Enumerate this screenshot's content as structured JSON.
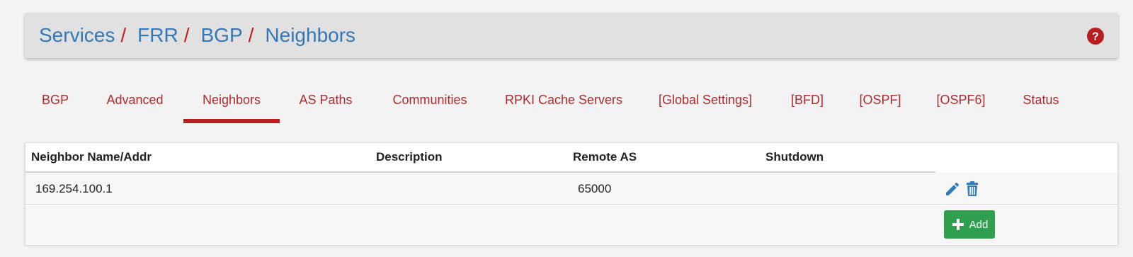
{
  "breadcrumb": {
    "items": [
      "Services",
      "FRR",
      "BGP",
      "Neighbors"
    ],
    "separator": "/"
  },
  "tabs": [
    {
      "label": "BGP",
      "active": false
    },
    {
      "label": "Advanced",
      "active": false
    },
    {
      "label": "Neighbors",
      "active": true
    },
    {
      "label": "AS Paths",
      "active": false
    },
    {
      "label": "Communities",
      "active": false
    },
    {
      "label": "RPKI Cache Servers",
      "active": false
    },
    {
      "label": "[Global Settings]",
      "active": false
    },
    {
      "label": "[BFD]",
      "active": false
    },
    {
      "label": "[OSPF]",
      "active": false
    },
    {
      "label": "[OSPF6]",
      "active": false
    },
    {
      "label": "Status",
      "active": false
    }
  ],
  "table": {
    "columns": [
      "Neighbor Name/Addr",
      "Description",
      "Remote AS",
      "Shutdown"
    ],
    "rows": [
      {
        "neighbor": "169.254.100.1",
        "description": "",
        "remote_as": "65000",
        "shutdown": ""
      }
    ]
  },
  "add_button": {
    "label": "Add"
  },
  "icons": {
    "help": "question-circle-icon",
    "edit": "pencil-icon",
    "delete": "trash-icon",
    "add": "plus-icon"
  },
  "colors": {
    "link_blue": "#3478b7",
    "accent_red": "#b81d22",
    "add_green": "#2e9e4f"
  }
}
